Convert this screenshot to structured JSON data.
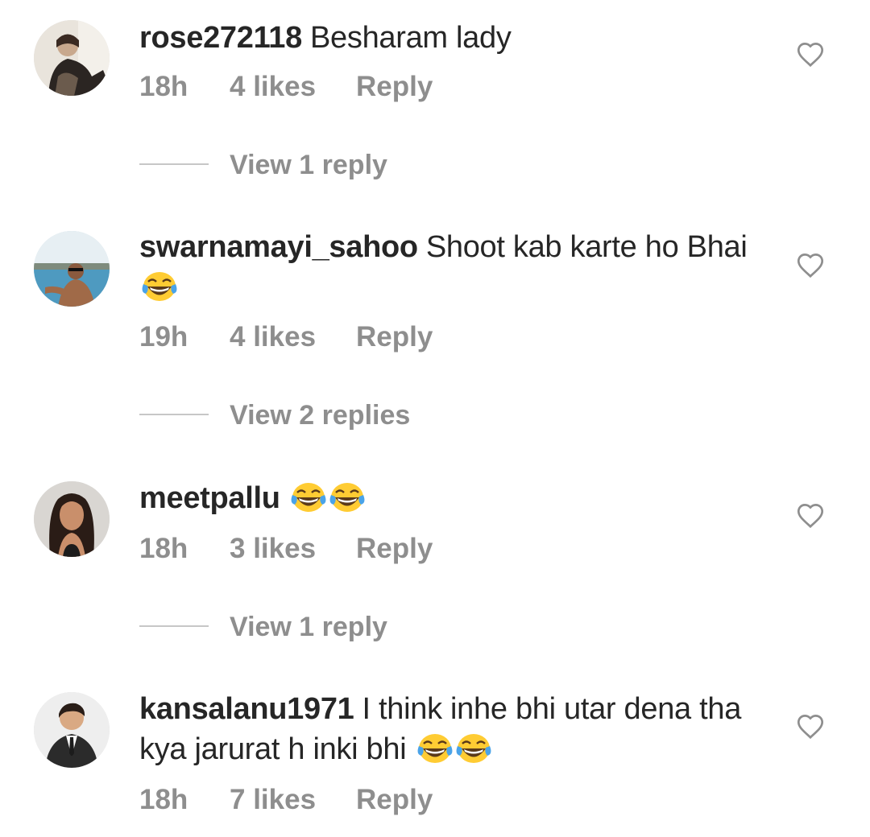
{
  "comments": [
    {
      "username": "rose272118",
      "text": "Besharam lady",
      "time": "18h",
      "likes": "4 likes",
      "reply": "Reply",
      "view_replies": "View 1 reply"
    },
    {
      "username": "swarnamayi_sahoo",
      "text": "Shoot kab karte ho Bhai",
      "time": "19h",
      "likes": "4 likes",
      "reply": "Reply",
      "view_replies": "View 2 replies"
    },
    {
      "username": "meetpallu",
      "text": "",
      "time": "18h",
      "likes": "3 likes",
      "reply": "Reply",
      "view_replies": "View 1 reply"
    },
    {
      "username": "kansalanu1971",
      "text": "I think inhe bhi utar dena tha kya jarurat h inki bhi",
      "time": "18h",
      "likes": "7 likes",
      "reply": "Reply"
    }
  ],
  "icons": {
    "like": "heart-outline-icon",
    "emoji": "face-with-tears-of-joy-emoji"
  },
  "colors": {
    "primary_text": "#262626",
    "secondary_text": "#8e8e8e",
    "divider": "#c7c7c7"
  }
}
